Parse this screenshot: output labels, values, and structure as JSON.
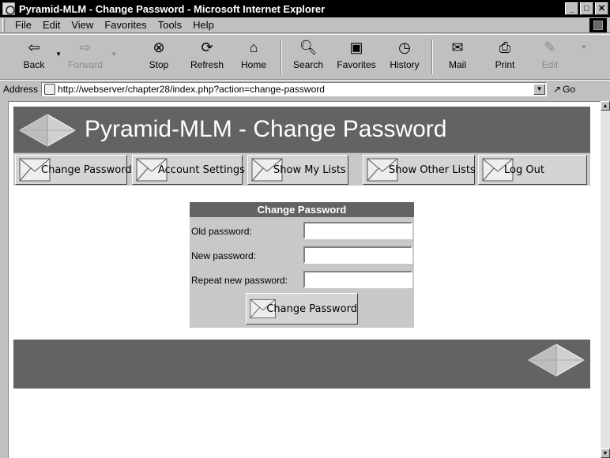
{
  "window": {
    "title": "Pyramid-MLM - Change Password - Microsoft Internet Explorer",
    "buttons": {
      "minimize": "_",
      "maximize": "□",
      "close": "✕"
    }
  },
  "menu": [
    "File",
    "Edit",
    "View",
    "Favorites",
    "Tools",
    "Help"
  ],
  "toolbar": {
    "back": "Back",
    "forward": "Forward",
    "stop": "Stop",
    "refresh": "Refresh",
    "home": "Home",
    "search": "Search",
    "favorites": "Favorites",
    "history": "History",
    "mail": "Mail",
    "print": "Print",
    "edit": "Edit"
  },
  "address": {
    "label": "Address",
    "url": "http://webserver/chapter28/index.php?action=change-password",
    "go": "Go"
  },
  "page": {
    "title": "Pyramid-MLM - Change Password",
    "nav": [
      "Change Password",
      "Account Settings",
      "Show My Lists",
      "Show Other Lists",
      "Log Out"
    ]
  },
  "form": {
    "title": "Change Password",
    "old_label": "Old password:",
    "new_label": "New password:",
    "repeat_label": "Repeat new password:",
    "old_value": "",
    "new_value": "",
    "repeat_value": "",
    "submit": "Change Password"
  },
  "icons": {
    "logo": "pyramid-icon",
    "nav": "envelope-icon"
  },
  "colors": {
    "banner": "#636363",
    "chrome": "#c0c0c0",
    "titlebar": "#000000"
  }
}
